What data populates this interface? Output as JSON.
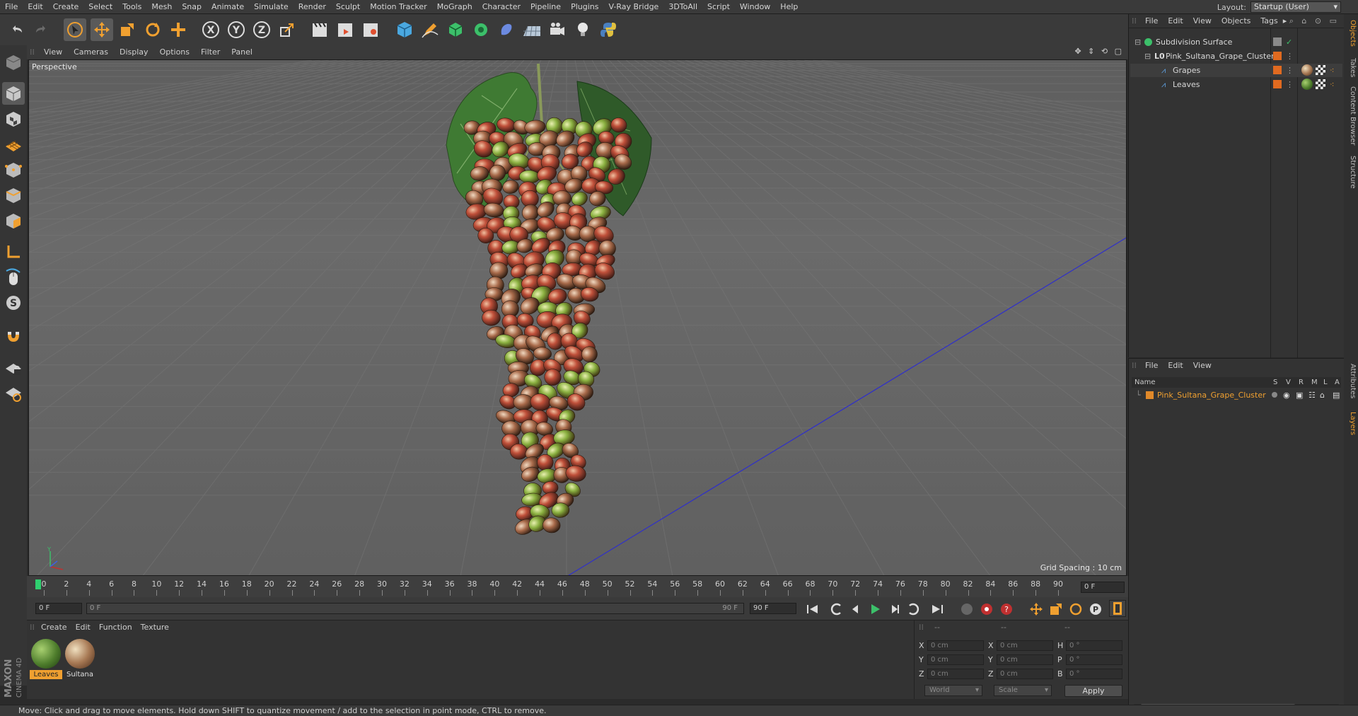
{
  "menubar": {
    "items": [
      "File",
      "Edit",
      "Create",
      "Select",
      "Tools",
      "Mesh",
      "Snap",
      "Animate",
      "Simulate",
      "Render",
      "Sculpt",
      "Motion Tracker",
      "MoGraph",
      "Character",
      "Pipeline",
      "Plugins",
      "V-Ray Bridge",
      "3DToAll",
      "Script",
      "Window",
      "Help"
    ],
    "layout_label": "Layout:",
    "layout_value": "Startup (User)"
  },
  "viewport": {
    "menu": [
      "View",
      "Cameras",
      "Display",
      "Options",
      "Filter",
      "Panel"
    ],
    "label": "Perspective",
    "grid_spacing": "Grid Spacing : 10 cm"
  },
  "timeline": {
    "ticks": [
      "0",
      "2",
      "4",
      "6",
      "8",
      "10",
      "12",
      "14",
      "16",
      "18",
      "20",
      "22",
      "24",
      "26",
      "28",
      "30",
      "32",
      "34",
      "36",
      "38",
      "40",
      "42",
      "44",
      "46",
      "48",
      "50",
      "52",
      "54",
      "56",
      "58",
      "60",
      "62",
      "64",
      "66",
      "68",
      "70",
      "72",
      "74",
      "76",
      "78",
      "80",
      "82",
      "84",
      "86",
      "88",
      "90"
    ],
    "end_frame": "0 F",
    "current_frame": "0 F",
    "range_start": "0 F",
    "range_end": "90 F",
    "max_frame": "90 F"
  },
  "material_manager": {
    "menu": [
      "Create",
      "Edit",
      "Function",
      "Texture"
    ],
    "materials": [
      {
        "label": "Leaves",
        "selected": true,
        "color": "#4e7d2c"
      },
      {
        "label": "Sultana",
        "selected": false,
        "color": "#9a7a55"
      }
    ]
  },
  "coordinates": {
    "headers": [
      "--",
      "--",
      "--"
    ],
    "rows": [
      {
        "axis": "X",
        "pos": "0 cm",
        "saxis": "X",
        "size": "0 cm",
        "raxis": "H",
        "rot": "0 °"
      },
      {
        "axis": "Y",
        "pos": "0 cm",
        "saxis": "Y",
        "size": "0 cm",
        "raxis": "P",
        "rot": "0 °"
      },
      {
        "axis": "Z",
        "pos": "0 cm",
        "saxis": "Z",
        "size": "0 cm",
        "raxis": "B",
        "rot": "0 °"
      }
    ],
    "space": "World",
    "mode": "Scale",
    "apply": "Apply"
  },
  "object_manager": {
    "menu": [
      "File",
      "Edit",
      "View",
      "Objects",
      "Tags"
    ],
    "objects": [
      {
        "name": "Subdivision Surface",
        "level": 0
      },
      {
        "name": "Pink_Sultana_Grape_Cluster",
        "level": 1
      },
      {
        "name": "Grapes",
        "level": 2
      },
      {
        "name": "Leaves",
        "level": 2
      }
    ]
  },
  "layer_manager": {
    "menu": [
      "File",
      "Edit",
      "View"
    ],
    "columns": [
      "Name",
      "S",
      "V",
      "R",
      "M",
      "L",
      "A"
    ],
    "layers": [
      {
        "name": "Pink_Sultana_Grape_Cluster",
        "color": "#e0892a"
      }
    ]
  },
  "side_tabs": [
    "Objects",
    "Takes",
    "Content Browser",
    "Structure",
    "Attributes",
    "Layers"
  ],
  "status": "Move: Click and drag to move elements. Hold down SHIFT to quantize movement / add to the selection in point mode, CTRL to remove.",
  "colors": {
    "accent": "#f0a030",
    "timeline_marker": "#2fcf6f",
    "axis_line": "#3030c8"
  }
}
